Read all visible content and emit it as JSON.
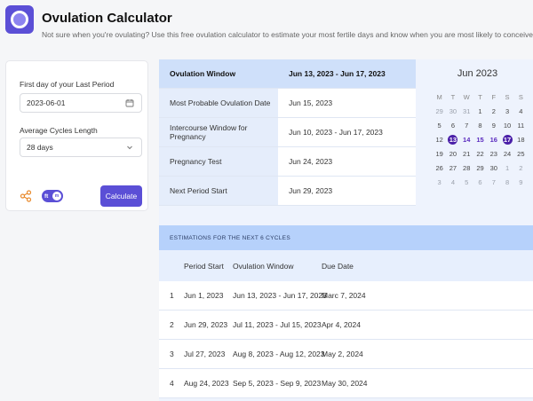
{
  "header": {
    "logo_icon": "ovulation-ring-icon",
    "title": "Ovulation Calculator",
    "subtitle": "Not sure when you're ovulating? Use this free ovulation calculator to estimate your most fertile days and know when you are most likely to conceive."
  },
  "form": {
    "period_label": "First day of your Last Period",
    "period_value": "2023-06-01",
    "cycle_label": "Average Cycles Length",
    "cycle_value": "28 days",
    "toggle_label": "ft",
    "toggle_knob": "m",
    "calculate_label": "Calculate",
    "accent_color": "#5b4fd6"
  },
  "summary": [
    {
      "label": "Ovulation Window",
      "value": "Jun 13, 2023 - Jun 17, 2023",
      "highlight": true
    },
    {
      "label": "Most Probable Ovulation Date",
      "value": "Jun 15, 2023"
    },
    {
      "label": "Intercourse Window for Pregnancy",
      "value": "Jun 10, 2023 - Jun 17, 2023"
    },
    {
      "label": "Pregnancy Test",
      "value": "Jun 24, 2023"
    },
    {
      "label": "Next Period Start",
      "value": "Jun 29, 2023"
    }
  ],
  "calendar": {
    "title": "Jun 2023",
    "weekdays": [
      "M",
      "T",
      "W",
      "T",
      "F",
      "S",
      "S"
    ],
    "weeks": [
      [
        {
          "d": "29",
          "t": "out"
        },
        {
          "d": "30",
          "t": "out"
        },
        {
          "d": "31",
          "t": "out"
        },
        {
          "d": "1"
        },
        {
          "d": "2"
        },
        {
          "d": "3"
        },
        {
          "d": "4"
        }
      ],
      [
        {
          "d": "5"
        },
        {
          "d": "6"
        },
        {
          "d": "7"
        },
        {
          "d": "8"
        },
        {
          "d": "9"
        },
        {
          "d": "10"
        },
        {
          "d": "11"
        }
      ],
      [
        {
          "d": "12"
        },
        {
          "d": "13",
          "t": "ovu"
        },
        {
          "d": "14",
          "t": "fert"
        },
        {
          "d": "15",
          "t": "fert"
        },
        {
          "d": "16",
          "t": "fert"
        },
        {
          "d": "17",
          "t": "ovu"
        },
        {
          "d": "18"
        }
      ],
      [
        {
          "d": "19"
        },
        {
          "d": "20"
        },
        {
          "d": "21"
        },
        {
          "d": "22"
        },
        {
          "d": "23"
        },
        {
          "d": "24"
        },
        {
          "d": "25"
        }
      ],
      [
        {
          "d": "26"
        },
        {
          "d": "27"
        },
        {
          "d": "28"
        },
        {
          "d": "29"
        },
        {
          "d": "30"
        },
        {
          "d": "1",
          "t": "out"
        },
        {
          "d": "2",
          "t": "out"
        }
      ],
      [
        {
          "d": "3",
          "t": "out"
        },
        {
          "d": "4",
          "t": "out"
        },
        {
          "d": "5",
          "t": "out"
        },
        {
          "d": "6",
          "t": "out"
        },
        {
          "d": "7",
          "t": "out"
        },
        {
          "d": "8",
          "t": "out"
        },
        {
          "d": "9",
          "t": "out"
        }
      ]
    ]
  },
  "estimations": {
    "heading": "ESTIMATIONS FOR THE NEXT 6 CYCLES",
    "columns": [
      "Period Start",
      "Ovulation Window",
      "Due Date"
    ],
    "rows": [
      {
        "n": "1",
        "start": "Jun 1, 2023",
        "window": "Jun 13, 2023 - Jun 17, 2023",
        "due": "Marc 7, 2024"
      },
      {
        "n": "2",
        "start": "Jun 29, 2023",
        "window": "Jul 11, 2023 - Jul 15, 2023",
        "due": "Apr 4, 2024"
      },
      {
        "n": "3",
        "start": "Jul 27, 2023",
        "window": "Aug 8, 2023 - Aug 12, 2023",
        "due": "May 2, 2024"
      },
      {
        "n": "4",
        "start": "Aug 24, 2023",
        "window": "Sep 5, 2023 - Sep 9, 2023",
        "due": "May 30, 2024"
      }
    ]
  }
}
